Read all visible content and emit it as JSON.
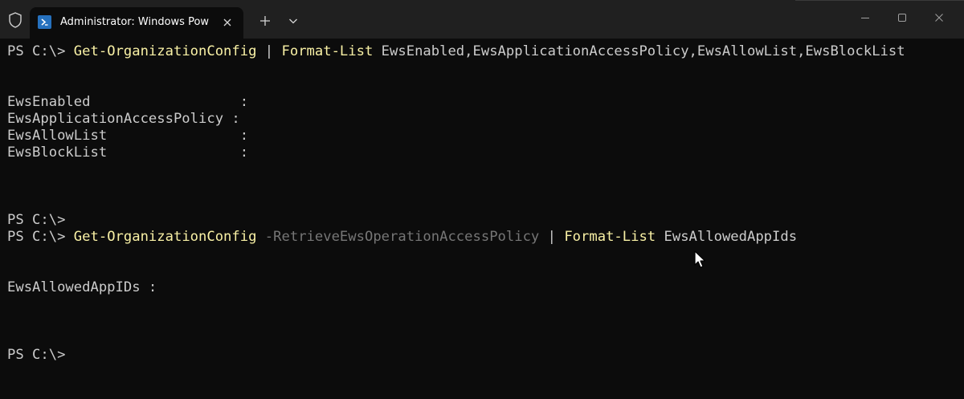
{
  "window": {
    "tab_title": "Administrator: Windows PowerShell",
    "icons": {
      "shield": "shield-icon",
      "tab": "powershell-icon",
      "close_tab": "close-icon",
      "new_tab": "plus-icon",
      "dropdown": "chevron-down-icon",
      "minimize": "minimize-icon",
      "maximize": "maximize-icon",
      "close_window": "close-icon"
    },
    "colors": {
      "background": "#0c0c0c",
      "titlebar": "#202020",
      "text": "#cccccc",
      "cmdlet": "#f9f1a5",
      "parameter": "#767676"
    }
  },
  "terminal": {
    "line1": {
      "prompt": "PS C:\\> ",
      "cmd1": "Get-OrganizationConfig",
      "pipe": " | ",
      "cmd2": "Format-List",
      "args": " EwsEnabled,EwsApplicationAccessPolicy,EwsAllowList,EwsBlockList"
    },
    "output1": [
      "EwsEnabled                  :",
      "EwsApplicationAccessPolicy :",
      "EwsAllowList                :",
      "EwsBlockList                :"
    ],
    "line2": {
      "prompt": "PS C:\\>"
    },
    "line3": {
      "prompt": "PS C:\\> ",
      "cmd1": "Get-OrganizationConfig",
      "param": " -RetrieveEwsOperationAccessPolicy",
      "pipe": " | ",
      "cmd2": "Format-List",
      "args": " EwsAllowedAppIds"
    },
    "output2": "EwsAllowedAppIDs :",
    "line4": {
      "prompt": "PS C:\\>"
    }
  }
}
